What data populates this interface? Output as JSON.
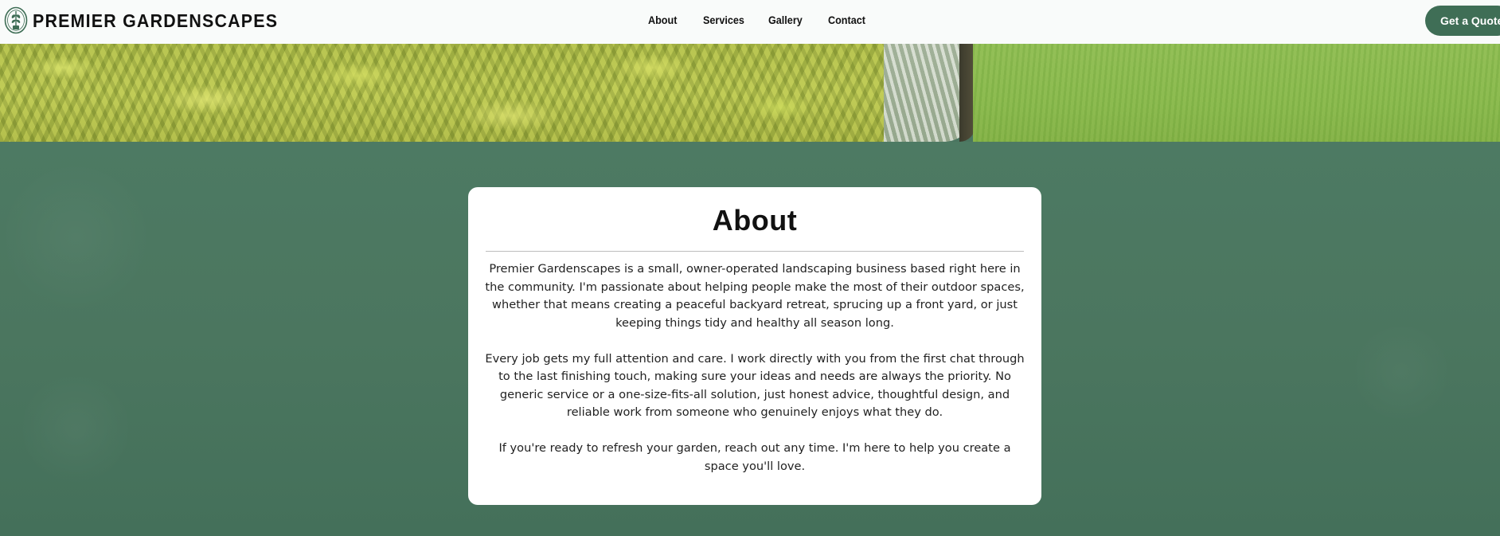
{
  "header": {
    "brand": "PREMIER GARDENSCAPES",
    "nav": [
      "About",
      "Services",
      "Gallery",
      "Contact"
    ],
    "cta": "Get a Quote"
  },
  "about": {
    "title": "About",
    "paragraphs": [
      "Premier Gardenscapes is a small, owner-operated landscaping business based right here in the community. I'm passionate about helping people make the most of their outdoor spaces, whether that means creating a peaceful backyard retreat, sprucing up a front yard, or just keeping things tidy and healthy all season long.",
      "Every job gets my full attention and care. I work directly with you from the first chat through to the last finishing touch, making sure your ideas and needs are always the priority. No generic service or a one-size-fits-all solution, just honest advice, thoughtful design, and reliable work from someone who genuinely enjoys what they do.",
      "If you're ready to refresh your garden, reach out any time. I'm here to help you create a space you'll love."
    ]
  },
  "colors": {
    "accent": "#3f6e56",
    "section_bg": "#4b765f",
    "card_bg": "#ffffff"
  },
  "icons": {
    "logo": "garden-emblem-icon"
  }
}
